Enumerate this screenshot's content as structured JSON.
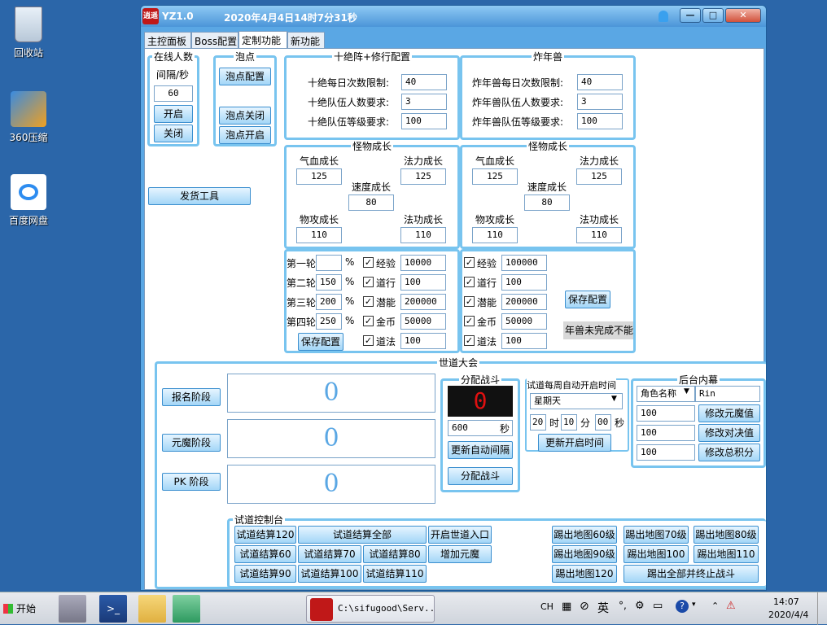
{
  "desktop": {
    "icons": [
      {
        "label": "回收站"
      },
      {
        "label": "360压缩"
      },
      {
        "label": "百度网盘"
      }
    ]
  },
  "window": {
    "title_icon_text": "逍遥",
    "version": "YZ1.0",
    "datetime": "2020年4月4日14时7分31秒",
    "tabs": [
      "主控面板",
      "Boss配置",
      "定制功能",
      "新功能"
    ],
    "active_tab": 2
  },
  "online": {
    "group_title": "在线人数",
    "interval_label": "间隔/秒",
    "interval_value": "60",
    "open_btn": "开启",
    "close_btn": "关闭"
  },
  "bubble": {
    "group_title": "泡点",
    "config_btn": "泡点配置",
    "close_btn": "泡点关闭",
    "open_btn": "泡点开启"
  },
  "shijue": {
    "group_title": "十绝阵+修行配置",
    "rows": [
      {
        "label": "十绝每日次数限制:",
        "value": "40"
      },
      {
        "label": "十绝队伍人数要求:",
        "value": "3"
      },
      {
        "label": "十绝队伍等级要求:",
        "value": "100"
      }
    ]
  },
  "nianshou": {
    "group_title": "炸年兽",
    "rows": [
      {
        "label": "炸年兽每日次数限制:",
        "value": "40"
      },
      {
        "label": "炸年兽队伍人数要求:",
        "value": "3"
      },
      {
        "label": "炸年兽队伍等级要求:",
        "value": "100"
      }
    ]
  },
  "growth_left": {
    "group_title": "怪物成长",
    "hp_label": "气血成长",
    "hp": "125",
    "mp_label": "法力成长",
    "mp": "125",
    "spd_label": "速度成长",
    "spd": "80",
    "atk_label": "物攻成长",
    "atk": "110",
    "matk_label": "法功成长",
    "matk": "110"
  },
  "growth_right": {
    "group_title": "怪物成长",
    "hp_label": "气血成长",
    "hp": "125",
    "mp_label": "法力成长",
    "mp": "125",
    "spd_label": "速度成长",
    "spd": "80",
    "atk_label": "物攻成长",
    "atk": "110",
    "matk_label": "法功成长",
    "matk": "110"
  },
  "rounds": {
    "rows": [
      {
        "label": "第一轮",
        "value": "",
        "unit": "%"
      },
      {
        "label": "第二轮",
        "value": "150",
        "unit": "%"
      },
      {
        "label": "第三轮",
        "value": "200",
        "unit": "%"
      },
      {
        "label": "第四轮",
        "value": "250",
        "unit": "%"
      }
    ],
    "rewards": [
      {
        "label": "经验",
        "value": "10000"
      },
      {
        "label": "道行",
        "value": "100"
      },
      {
        "label": "潜能",
        "value": "200000"
      },
      {
        "label": "金币",
        "value": "50000"
      },
      {
        "label": "道法",
        "value": "100"
      }
    ],
    "save_btn": "保存配置"
  },
  "nian_rewards": {
    "rewards": [
      {
        "label": "经验",
        "value": "100000"
      },
      {
        "label": "道行",
        "value": "100"
      },
      {
        "label": "潜能",
        "value": "200000"
      },
      {
        "label": "金币",
        "value": "50000"
      },
      {
        "label": "道法",
        "value": "100"
      }
    ],
    "save_btn": "保存配置",
    "status": "年兽未完成不能"
  },
  "send_tool_btn": "发货工具",
  "shidao": {
    "group_title": "世道大会",
    "signup_btn": "报名阶段",
    "yuanmo_btn": "元魔阶段",
    "pk_btn": "PK 阶段",
    "signup_count": "0",
    "yuanmo_count": "0",
    "pk_count": "0",
    "fen_title": "分配战斗",
    "fen_display": "0",
    "fen_value": "600",
    "fen_unit": "秒",
    "update_interval_btn": "更新自动间隔",
    "fen_btn": "分配战斗",
    "weekly_title": "试道每周自动开启时间",
    "weekday": "星期天",
    "hour": "20",
    "hour_unit": "时",
    "minute": "10",
    "minute_unit": "分",
    "second": "00",
    "second_unit": "秒",
    "update_time_btn": "更新开启时间",
    "backend_title": "后台内幕",
    "role_select": "角色名称",
    "role_name": "Rin",
    "v1": "100",
    "b1": "修改元魔值",
    "v2": "100",
    "b2": "修改对决值",
    "v3": "100",
    "b3": "修改总积分"
  },
  "control": {
    "group_title": "试道控制台",
    "buttons": {
      "settle120": "试道结算120",
      "settle_all": "试道结算全部",
      "open_entrance": "开启世道入口",
      "settle60": "试道结算60",
      "settle70": "试道结算70",
      "settle80": "试道结算80",
      "add_yuanmo": "增加元魔",
      "settle90": "试道结算90",
      "settle100": "试道结算100",
      "settle110": "试道结算110",
      "kick60": "踢出地图60级",
      "kick70": "踢出地图70级",
      "kick80": "踢出地图80级",
      "kick90": "踢出地图90级",
      "kick100": "踢出地图100",
      "kick110": "踢出地图110",
      "kick120": "踢出地图120",
      "kick_all": "踢出全部并终止战斗"
    }
  },
  "taskbar": {
    "start": "开始",
    "task_label": "C:\\sifugood\\Serv...",
    "tray_ch": "CH",
    "tray_ime": "英",
    "time": "14:07",
    "date": "2020/4/4"
  },
  "colors": {
    "desktop": "#2b66a9",
    "frame": "#5aa7e4",
    "group_border": "#78c4ef",
    "led_red": "#e01010"
  }
}
